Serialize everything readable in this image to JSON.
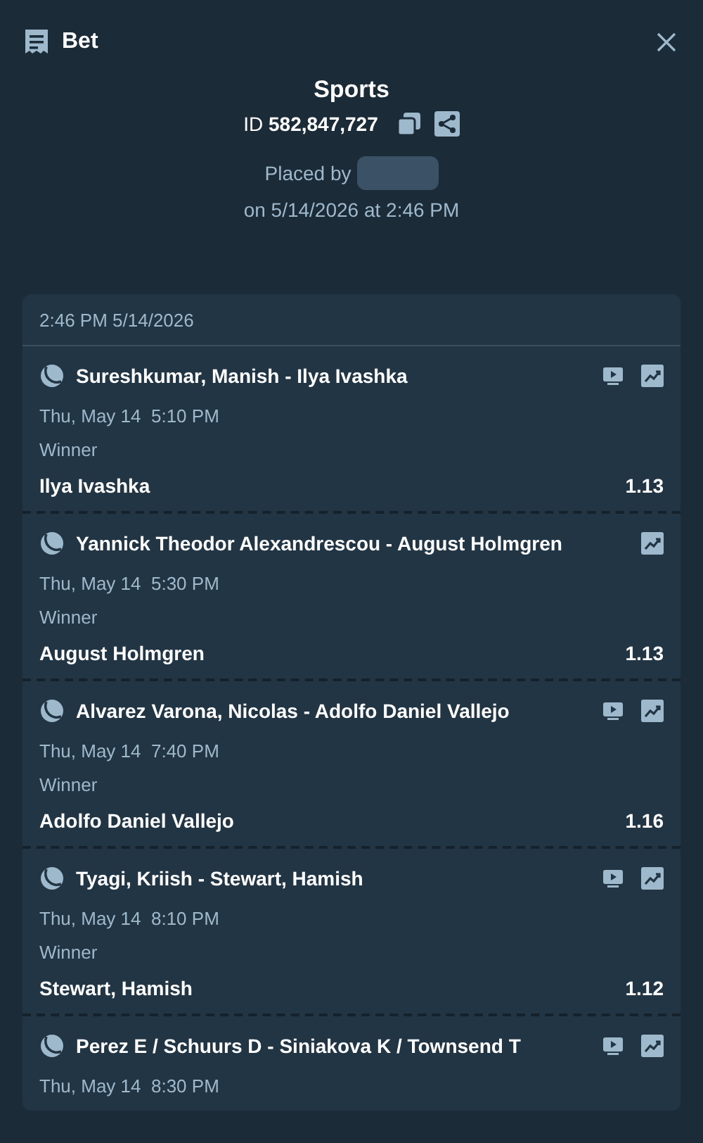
{
  "header": {
    "title": "Bet"
  },
  "summary": {
    "type": "Sports",
    "id_label": "ID",
    "id_value": "582,847,727",
    "placed_by": "Placed by",
    "placed_on": "on 5/14/2026 at 2:46 PM"
  },
  "card": {
    "timestamp": "2:46 PM 5/14/2026",
    "legs": [
      {
        "match": "Sureshkumar, Manish - Ilya Ivashka",
        "stream": true,
        "datetime": "Thu, May 14  5:10 PM",
        "market": "Winner",
        "selection": "Ilya Ivashka",
        "odds": "1.13"
      },
      {
        "match": "Yannick Theodor Alexandrescou - August Holmgren",
        "stream": false,
        "datetime": "Thu, May 14  5:30 PM",
        "market": "Winner",
        "selection": "August Holmgren",
        "odds": "1.13"
      },
      {
        "match": "Alvarez Varona, Nicolas - Adolfo Daniel Vallejo",
        "stream": true,
        "datetime": "Thu, May 14  7:40 PM",
        "market": "Winner",
        "selection": "Adolfo Daniel Vallejo",
        "odds": "1.16"
      },
      {
        "match": "Tyagi, Kriish - Stewart, Hamish",
        "stream": true,
        "datetime": "Thu, May 14  8:10 PM",
        "market": "Winner",
        "selection": "Stewart, Hamish",
        "odds": "1.12"
      },
      {
        "match": "Perez E / Schuurs D - Siniakova K / Townsend T",
        "stream": true,
        "datetime": "Thu, May 14  8:30 PM"
      }
    ]
  }
}
